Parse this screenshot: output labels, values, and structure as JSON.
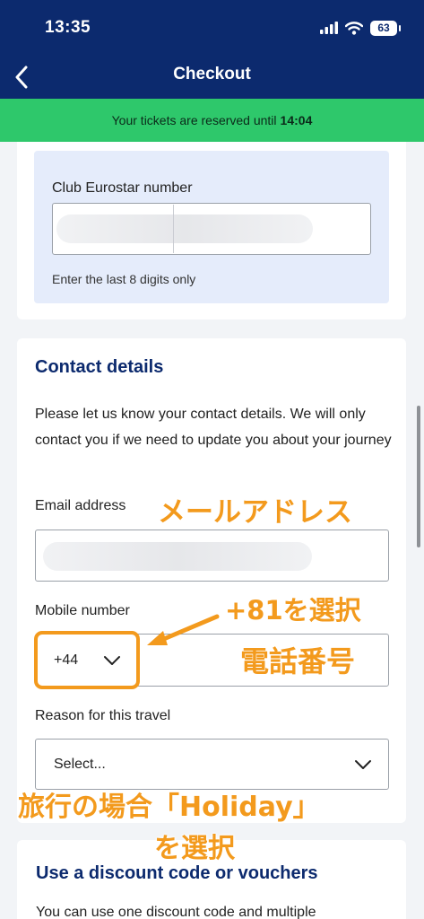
{
  "status_bar": {
    "time": "13:35",
    "battery": "63"
  },
  "nav": {
    "title": "Checkout"
  },
  "banner": {
    "text": "Your tickets are reserved until",
    "time": "14:04"
  },
  "club": {
    "label": "Club Eurostar number",
    "hint": "Enter the last 8 digits only"
  },
  "contact": {
    "title": "Contact details",
    "intro": "Please let us know your contact details. We will only contact you if we need to update you about your journey",
    "email_label": "Email address",
    "mobile_label": "Mobile number",
    "country_code": "+44",
    "reason_label": "Reason for this travel",
    "reason_value": "Select..."
  },
  "discount": {
    "title": "Use a discount code or vouchers",
    "text": "You can use one discount code and multiple"
  },
  "annotations": {
    "email": "メールアドレス",
    "country_code": "+81を選択",
    "phone": "電話番号",
    "holiday": "旅行の場合「Holiday」",
    "select": "を選択"
  },
  "colors": {
    "brand_navy": "#0c2a6e",
    "banner_green": "#2ec86b",
    "club_panel": "#e5ecfb",
    "annotation_orange": "#f39a1d"
  },
  "icons": [
    "cellular-signal-icon",
    "wifi-icon",
    "battery-icon",
    "back-chevron-icon",
    "chevron-down-icon"
  ]
}
